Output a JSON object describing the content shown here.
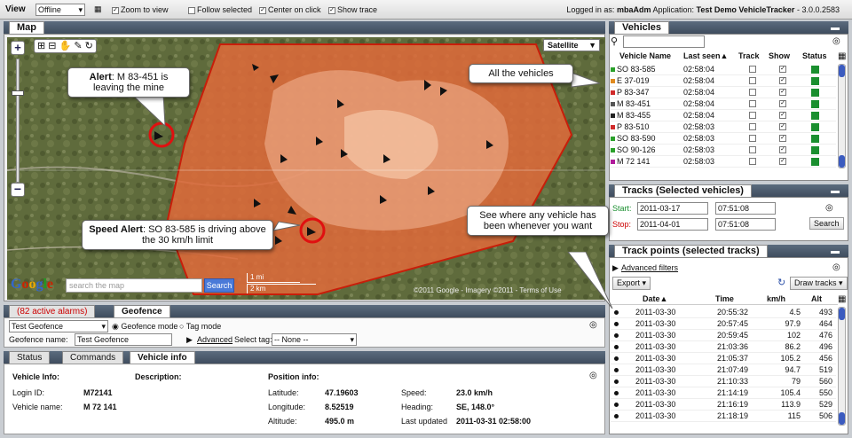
{
  "topbar": {
    "view_label": "View",
    "view_value": "Offline",
    "zoom_to_view": "Zoom to view",
    "follow_selected": "Follow selected",
    "center_on_click": "Center on click",
    "show_trace": "Show trace",
    "logged_in_prefix": "Logged in as:",
    "user": "mbaAdm",
    "application_prefix": "Application:",
    "app_name": "Test Demo VehicleTracker",
    "version": "- 3.0.0.2583"
  },
  "map_panel": {
    "tab": "Map",
    "map_type": "Satellite",
    "search_placeholder": "search the map",
    "search_button": "Search",
    "scale_top": "1 mi",
    "scale_bottom": "2 km",
    "copyright": "©2011 Google - Imagery ©2011 - Terms of Use",
    "google_logo": "Google"
  },
  "callouts": {
    "alert_bold": "Alert",
    "alert_text": ": M 83-451 is leaving the mine",
    "speed_bold": "Speed Alert",
    "speed_text": ": SO 83-585 is driving above the 30 km/h limit",
    "all_vehicles": "All the vehicles",
    "see_where": "See where any vehicle has been whenever you want"
  },
  "alarms_panel": {
    "tab_alarms": "(82 active alarms)",
    "tab_geofence": "Geofence",
    "geofence_select": "Test Geofence",
    "geofence_mode": "Geofence mode",
    "tag_mode": "Tag mode",
    "geofence_name_label": "Geofence name:",
    "geofence_name_value": "Test Geofence",
    "advanced": "Advanced",
    "select_tag_label": "Select tag:",
    "select_tag_value": "-- None --"
  },
  "info_panel": {
    "tabs": [
      "Status",
      "Commands",
      "Vehicle info"
    ],
    "vehicle_info_header": "Vehicle Info:",
    "description_header": "Description:",
    "position_info_header": "Position info:",
    "login_id_label": "Login ID:",
    "login_id_value": "M72141",
    "vehicle_name_label": "Vehicle name:",
    "vehicle_name_value": "M 72 141",
    "latitude_label": "Latitude:",
    "latitude_value": "47.19603",
    "longitude_label": "Longitude:",
    "longitude_value": "8.52519",
    "altitude_label": "Altitude:",
    "altitude_value": "495.0 m",
    "speed_label": "Speed:",
    "speed_value": "23.0 km/h",
    "heading_label": "Heading:",
    "heading_value": "SE, 148.0°",
    "last_updated_label": "Last updated",
    "last_updated_value": "2011-03-31 02:58:00"
  },
  "vehicles_panel": {
    "tab": "Vehicles",
    "columns": [
      "Vehicle Name",
      "Last seen▲",
      "Track",
      "Show",
      "Status"
    ],
    "rows": [
      {
        "name": "SO 83-585",
        "last_seen": "02:58:04",
        "color": "#2aa02a"
      },
      {
        "name": "E 37-019",
        "last_seen": "02:58:04",
        "color": "#e08a1e"
      },
      {
        "name": "P 83-347",
        "last_seen": "02:58:04",
        "color": "#d02a2a"
      },
      {
        "name": "M 83-451",
        "last_seen": "02:58:04",
        "color": "#555555"
      },
      {
        "name": "M 83-455",
        "last_seen": "02:58:04",
        "color": "#222222"
      },
      {
        "name": "P 83-510",
        "last_seen": "02:58:03",
        "color": "#d02a2a"
      },
      {
        "name": "SO 83-590",
        "last_seen": "02:58:03",
        "color": "#2aa02a"
      },
      {
        "name": "SO 90-126",
        "last_seen": "02:58:03",
        "color": "#2aa02a"
      },
      {
        "name": "M 72 141",
        "last_seen": "02:58:03",
        "color": "#b01a9a"
      }
    ]
  },
  "tracks_panel": {
    "tab": "Tracks (Selected vehicles)",
    "start_label": "Start:",
    "start_date": "2011-03-17",
    "start_time": "07:51:08",
    "stop_label": "Stop:",
    "stop_date": "2011-04-01",
    "stop_time": "07:51:08",
    "search_button": "Search"
  },
  "trackpoints_panel": {
    "tab": "Track points (selected tracks)",
    "advanced_filters": "Advanced filters",
    "export": "Export",
    "draw_tracks": "Draw tracks",
    "columns": [
      "Date▲",
      "Time",
      "km/h",
      "Alt"
    ],
    "rows": [
      {
        "date": "2011-03-30",
        "time": "20:55:32",
        "kmh": "4.5",
        "alt": "493"
      },
      {
        "date": "2011-03-30",
        "time": "20:57:45",
        "kmh": "97.9",
        "alt": "464"
      },
      {
        "date": "2011-03-30",
        "time": "20:59:45",
        "kmh": "102",
        "alt": "476"
      },
      {
        "date": "2011-03-30",
        "time": "21:03:36",
        "kmh": "86.2",
        "alt": "496"
      },
      {
        "date": "2011-03-30",
        "time": "21:05:37",
        "kmh": "105.2",
        "alt": "456"
      },
      {
        "date": "2011-03-30",
        "time": "21:07:49",
        "kmh": "94.7",
        "alt": "519"
      },
      {
        "date": "2011-03-30",
        "time": "21:10:33",
        "kmh": "79",
        "alt": "560"
      },
      {
        "date": "2011-03-30",
        "time": "21:14:19",
        "kmh": "105.4",
        "alt": "550"
      },
      {
        "date": "2011-03-30",
        "time": "21:16:19",
        "kmh": "113.9",
        "alt": "529"
      },
      {
        "date": "2011-03-30",
        "time": "21:18:19",
        "kmh": "115",
        "alt": "506"
      }
    ]
  },
  "colors": {
    "header_dark": "#3f4d5e",
    "geofence_red": "#d63a1c",
    "alarm_red": "#cc0000",
    "status_green": "#1a8f2f"
  }
}
